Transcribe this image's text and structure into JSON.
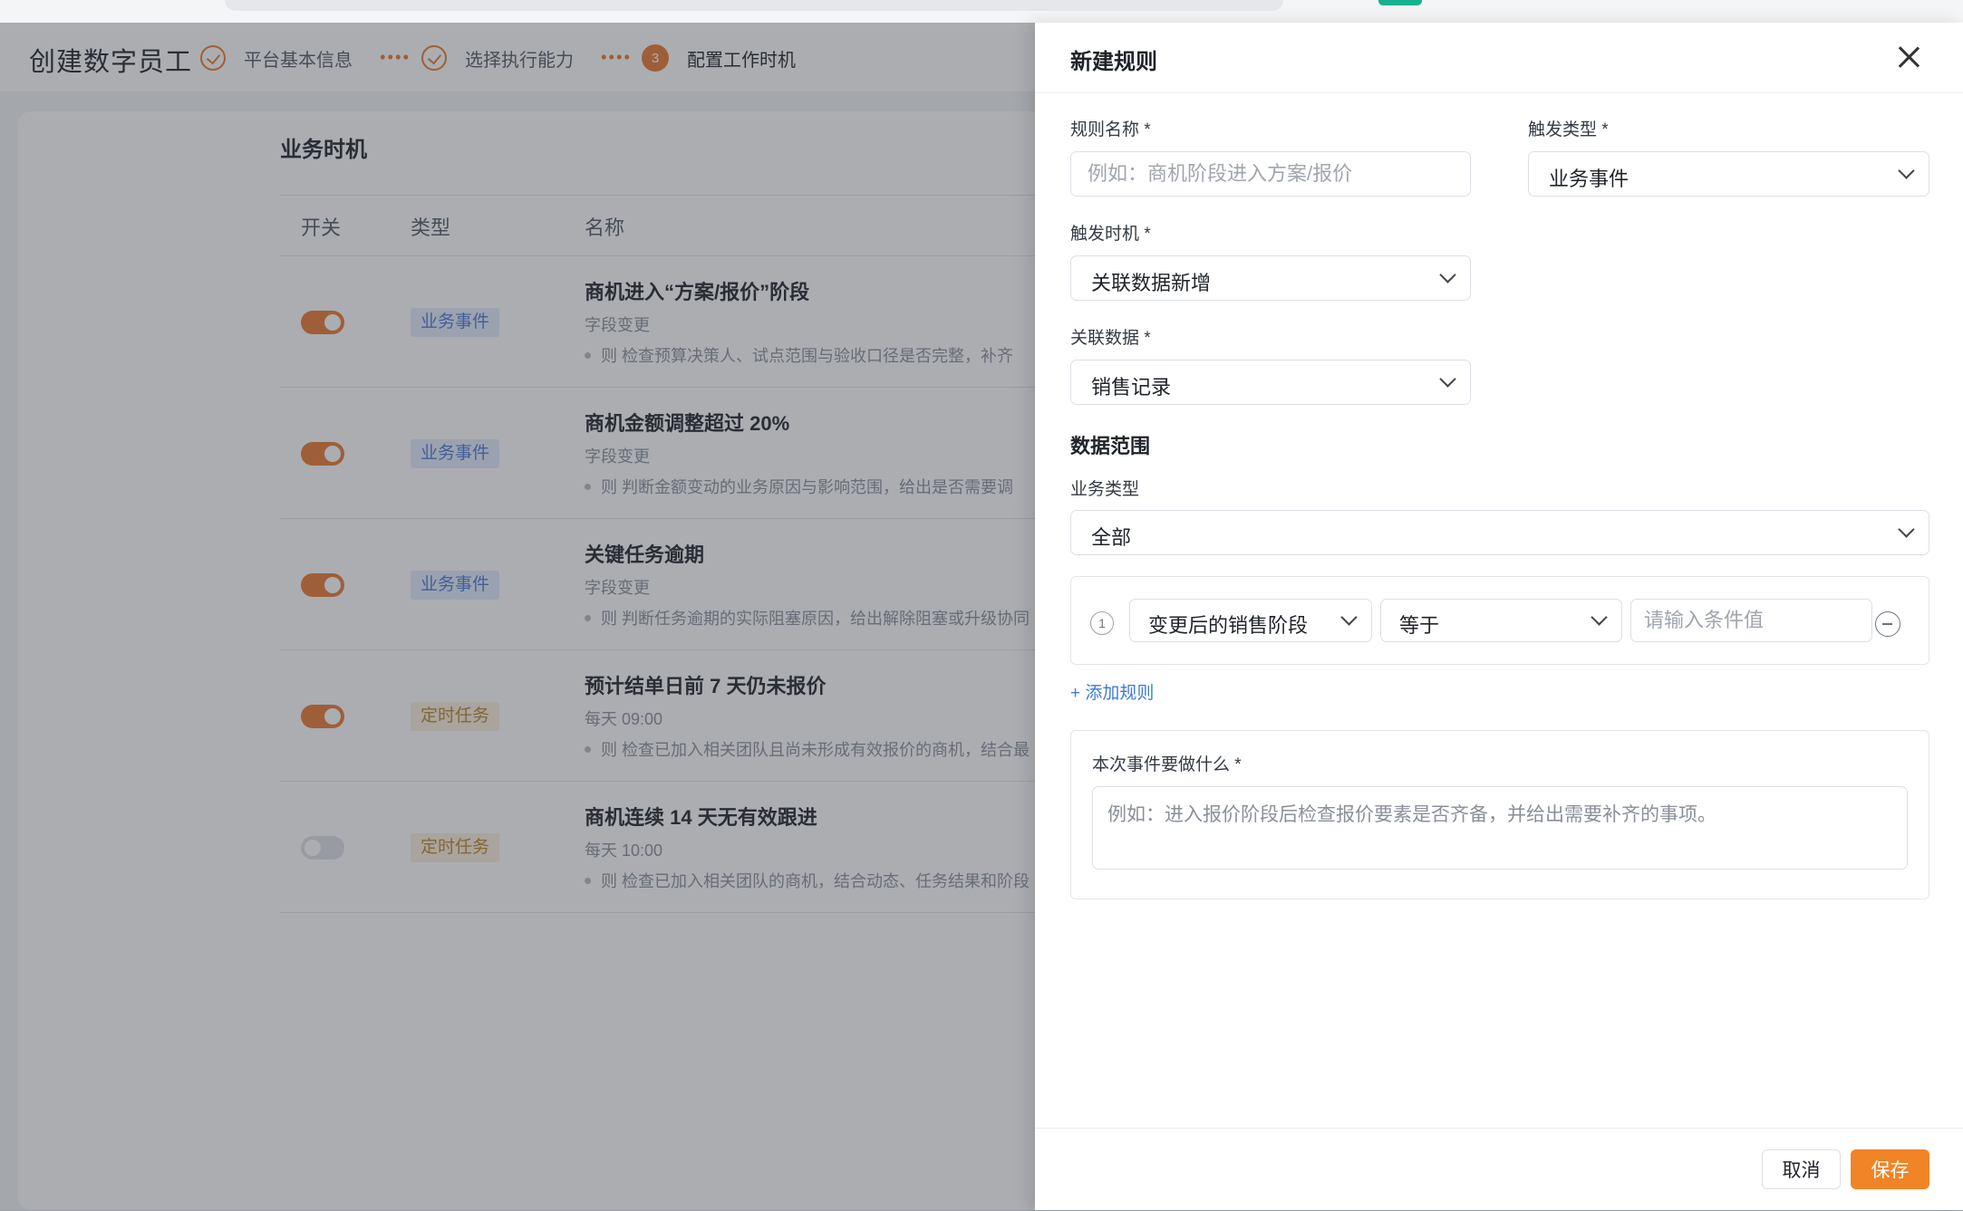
{
  "header": {
    "app_title": "创建数字员工",
    "steps": [
      {
        "label": "平台基本信息",
        "status": "done"
      },
      {
        "label": "选择执行能力",
        "status": "done"
      },
      {
        "label": "配置工作时机",
        "status": "active",
        "number": "3"
      }
    ]
  },
  "main": {
    "section_title": "业务时机",
    "columns": [
      "开关",
      "类型",
      "名称"
    ],
    "rows": [
      {
        "enabled": true,
        "type": "业务事件",
        "name": "商机进入“方案/报价”阶段",
        "sub": "字段变更",
        "desc": "则 检查预算决策人、试点范围与验收口径是否完整，补齐"
      },
      {
        "enabled": true,
        "type": "业务事件",
        "name": "商机金额调整超过 20%",
        "sub": "字段变更",
        "desc": "则 判断金额变动的业务原因与影响范围，给出是否需要调"
      },
      {
        "enabled": true,
        "type": "业务事件",
        "name": "关键任务逾期",
        "sub": "字段变更",
        "desc": "则 判断任务逾期的实际阻塞原因，给出解除阻塞或升级协同"
      },
      {
        "enabled": true,
        "type": "定时任务",
        "name": "预计结单日前 7 天仍未报价",
        "sub": "每天 09:00",
        "desc": "则 检查已加入相关团队且尚未形成有效报价的商机，结合最"
      },
      {
        "enabled": false,
        "type": "定时任务",
        "name": "商机连续 14 天无有效跟进",
        "sub": "每天 10:00",
        "desc": "则 检查已加入相关团队的商机，结合动态、任务结果和阶段"
      }
    ]
  },
  "drawer": {
    "title": "新建规则",
    "rule_name_label": "规则名称 *",
    "rule_name_placeholder": "例如：商机阶段进入方案/报价",
    "trigger_type_label": "触发类型 *",
    "trigger_type_value": "业务事件",
    "trigger_timing_label": "触发时机 *",
    "trigger_timing_value": "关联数据新增",
    "related_data_label": "关联数据 *",
    "related_data_value": "销售记录",
    "scope_title": "数据范围",
    "biz_type_label": "业务类型",
    "biz_type_value": "全部",
    "condition": {
      "index": "1",
      "field": "变更后的销售阶段",
      "operator": "等于",
      "value_placeholder": "请输入条件值"
    },
    "add_rule_label": "+ 添加规则",
    "action_label": "本次事件要做什么 *",
    "action_placeholder": "例如：进入报价阶段后检查报价要素是否齐备，并给出需要补齐的事项。",
    "cancel_label": "取消",
    "save_label": "保存"
  },
  "colors": {
    "accent": "#f08426",
    "link": "#3d7bd9",
    "event_tag": "#4a78d6",
    "timer_tag": "#b9872e"
  }
}
